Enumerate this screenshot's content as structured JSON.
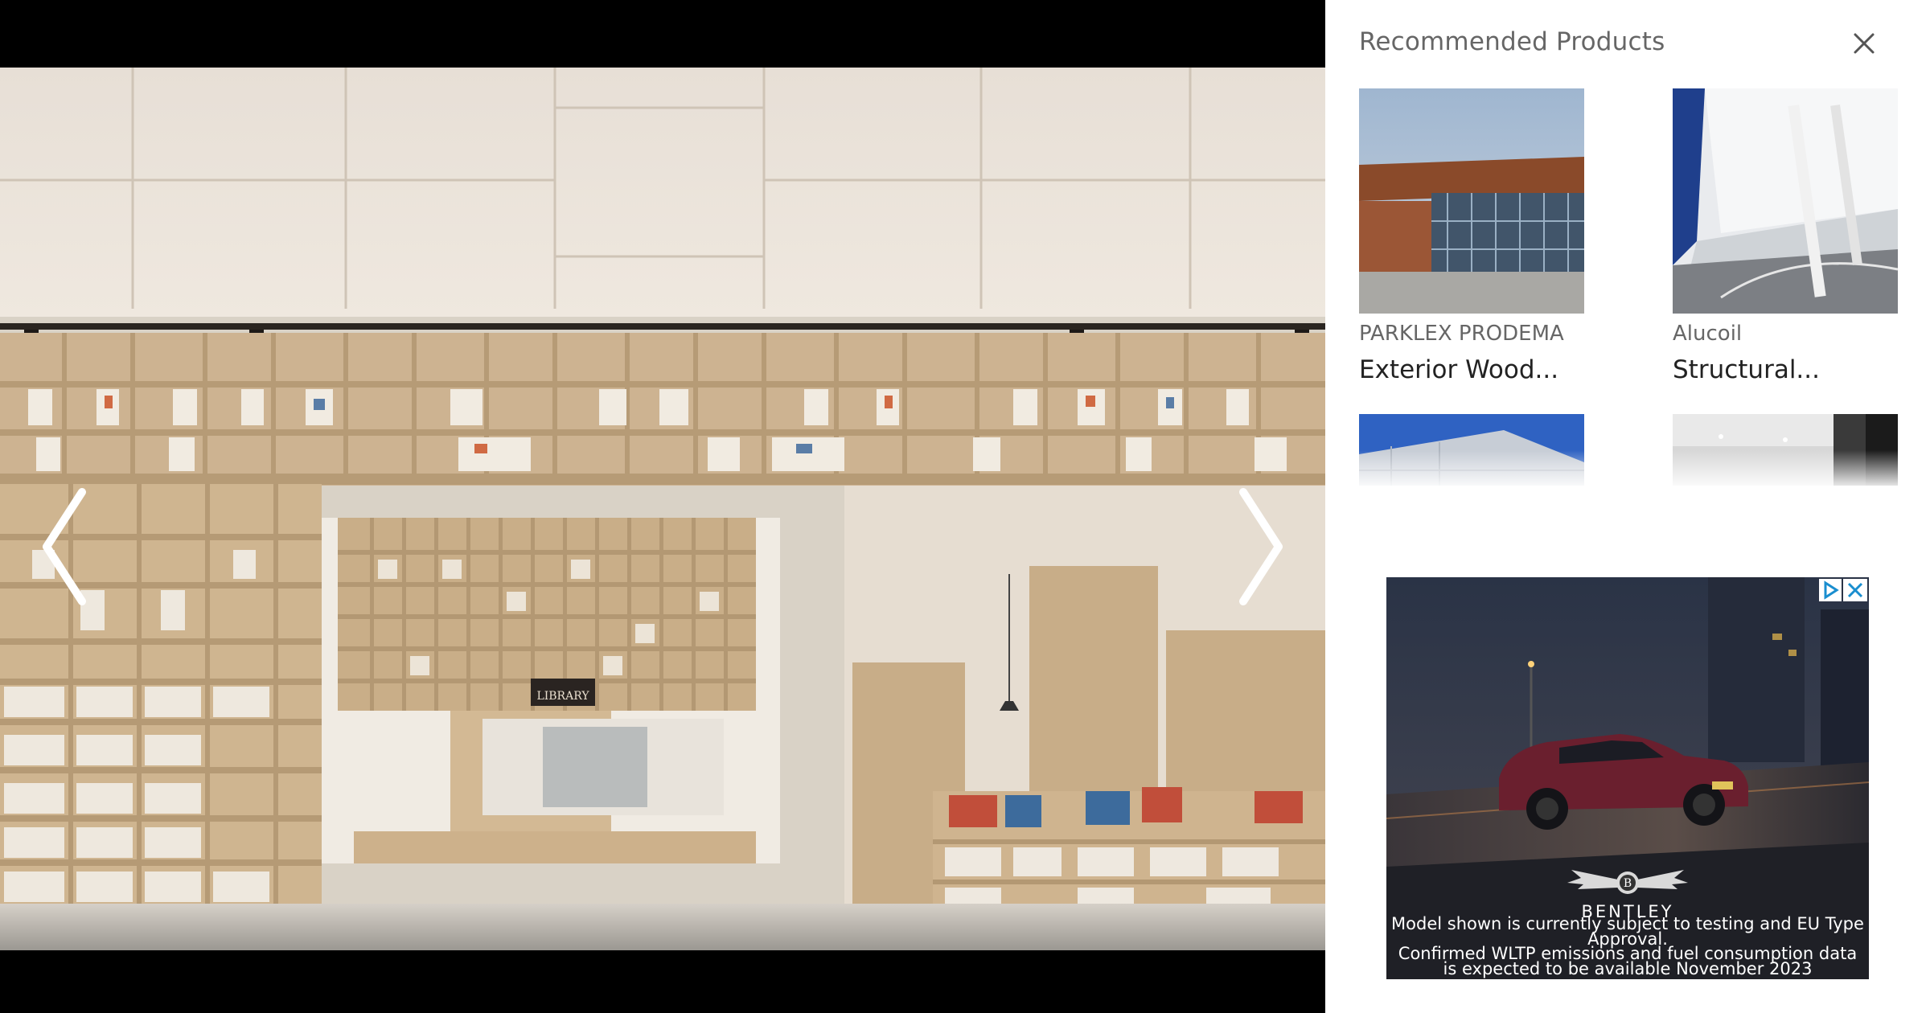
{
  "gallery": {
    "image_alt": "Library interior with plywood bookshelves",
    "library_sign": "LIBRARY",
    "prev_icon": "chevron-left-icon",
    "next_icon": "chevron-right-icon"
  },
  "panel": {
    "title": "Recommended Products",
    "close_icon": "close-icon",
    "products": [
      {
        "brand": "PARKLEX PRODEMA",
        "name": "Exterior Wood..."
      },
      {
        "brand": "Alucoil",
        "name": "Structural..."
      },
      {
        "brand": "",
        "name": ""
      },
      {
        "brand": "",
        "name": ""
      }
    ]
  },
  "ad": {
    "brand": "BENTLEY",
    "line1": "Model shown is currently subject to testing and EU Type",
    "line2": "Approval.",
    "line3": "Confirmed WLTP emissions and fuel consumption data",
    "line4": "is expected to be available November 2023",
    "choices_icon": "ad-choices-icon",
    "close_icon": "close-icon"
  },
  "colors": {
    "panel_bg": "#ffffff",
    "title_text": "#666666",
    "product_name": "#222222",
    "gallery_bg": "#000000"
  }
}
